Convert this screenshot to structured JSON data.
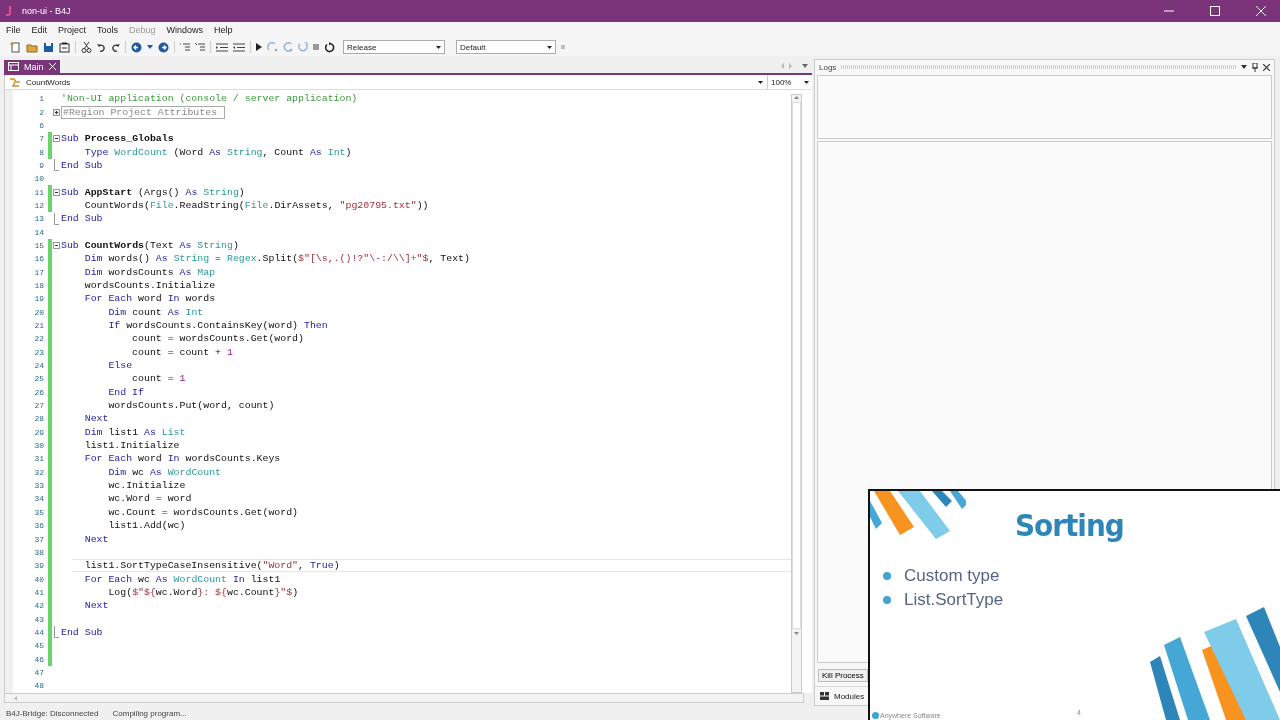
{
  "window": {
    "title": "non-ui - B4J"
  },
  "menu": [
    {
      "label": "File",
      "disabled": false
    },
    {
      "label": "Edit",
      "disabled": false
    },
    {
      "label": "Project",
      "disabled": false
    },
    {
      "label": "Tools",
      "disabled": false
    },
    {
      "label": "Debug",
      "disabled": true
    },
    {
      "label": "Windows",
      "disabled": false
    },
    {
      "label": "Help",
      "disabled": false
    }
  ],
  "toolbar": {
    "build_config": "Release",
    "build_target": "Default"
  },
  "tabs": [
    {
      "label": "Main",
      "selected": true
    }
  ],
  "editor": {
    "module": "CountWords",
    "zoom": "100%",
    "lines": [
      {
        "number": "1",
        "kind": "code",
        "changed": false,
        "current": false,
        "segments": [
          {
            "kind": "comment",
            "text": "'Non-UI application (console / server application)"
          }
        ]
      },
      {
        "number": "2",
        "kind": "fold_start",
        "expanded": false,
        "changed": false,
        "current": false,
        "segments": [
          {
            "kind": "region",
            "text": "#Region Project Attributes "
          }
        ]
      },
      {
        "number": "6",
        "kind": "code",
        "changed": false,
        "current": false
      },
      {
        "number": "7",
        "kind": "fold_start",
        "expanded": true,
        "changed": true,
        "current": false,
        "segments": [
          {
            "kind": "kw",
            "text": "Sub "
          },
          {
            "kind": "name",
            "text": "Process_Globals"
          }
        ]
      },
      {
        "number": "8",
        "kind": "code",
        "changed": true,
        "current": false,
        "segments": [
          {
            "kind": "kw",
            "text": "    Type "
          },
          {
            "kind": "type",
            "text": "WordCount"
          },
          {
            "kind": "plain",
            "text": " (Word "
          },
          {
            "kind": "kw",
            "text": "As "
          },
          {
            "kind": "type",
            "text": "String"
          },
          {
            "kind": "plain",
            "text": ", Count "
          },
          {
            "kind": "kw",
            "text": "As "
          },
          {
            "kind": "type",
            "text": "Int"
          },
          {
            "kind": "plain",
            "text": ")"
          }
        ]
      },
      {
        "number": "9",
        "kind": "fold_end",
        "changed": false,
        "current": false,
        "segments": [
          {
            "kind": "kw",
            "text": "End Sub"
          }
        ]
      },
      {
        "number": "10",
        "kind": "code",
        "changed": false,
        "current": false
      },
      {
        "number": "11",
        "kind": "fold_start",
        "expanded": true,
        "changed": true,
        "current": false,
        "segments": [
          {
            "kind": "kw",
            "text": "Sub "
          },
          {
            "kind": "name",
            "text": "AppStart"
          },
          {
            "kind": "plain",
            "text": " (Args() "
          },
          {
            "kind": "kw",
            "text": "As "
          },
          {
            "kind": "type",
            "text": "String"
          },
          {
            "kind": "plain",
            "text": ")"
          }
        ]
      },
      {
        "number": "12",
        "kind": "code",
        "changed": true,
        "current": false,
        "segments": [
          {
            "kind": "plain",
            "text": "    CountWords("
          },
          {
            "kind": "type",
            "text": "File"
          },
          {
            "kind": "plain",
            "text": ".ReadString("
          },
          {
            "kind": "type",
            "text": "File"
          },
          {
            "kind": "plain",
            "text": ".DirAssets, "
          },
          {
            "kind": "str",
            "text": "\"pg20795.txt\""
          },
          {
            "kind": "plain",
            "text": "))"
          }
        ]
      },
      {
        "number": "13",
        "kind": "fold_end",
        "changed": false,
        "current": false,
        "segments": [
          {
            "kind": "kw",
            "text": "End Sub"
          }
        ]
      },
      {
        "number": "14",
        "kind": "code",
        "changed": false,
        "current": false
      },
      {
        "number": "15",
        "kind": "fold_start",
        "expanded": true,
        "changed": true,
        "current": false,
        "segments": [
          {
            "kind": "kw",
            "text": "Sub "
          },
          {
            "kind": "name",
            "text": "CountWords"
          },
          {
            "kind": "plain",
            "text": "(Text "
          },
          {
            "kind": "kw",
            "text": "As "
          },
          {
            "kind": "type",
            "text": "String"
          },
          {
            "kind": "plain",
            "text": ")"
          }
        ]
      },
      {
        "number": "16",
        "kind": "code",
        "changed": true,
        "current": false,
        "segments": [
          {
            "kind": "kw",
            "text": "    Dim "
          },
          {
            "kind": "plain",
            "text": "words() "
          },
          {
            "kind": "kw",
            "text": "As "
          },
          {
            "kind": "type",
            "text": "String"
          },
          {
            "kind": "plain",
            "text": " = "
          },
          {
            "kind": "type",
            "text": "Regex"
          },
          {
            "kind": "plain",
            "text": ".Split("
          },
          {
            "kind": "str",
            "text": "$\"[\\s,.()!?\"\\-:/\\\\]+\"$"
          },
          {
            "kind": "plain",
            "text": ", Text)"
          }
        ]
      },
      {
        "number": "17",
        "kind": "code",
        "changed": true,
        "current": false,
        "segments": [
          {
            "kind": "kw",
            "text": "    Dim "
          },
          {
            "kind": "plain",
            "text": "wordsCounts "
          },
          {
            "kind": "kw",
            "text": "As "
          },
          {
            "kind": "type",
            "text": "Map"
          }
        ]
      },
      {
        "number": "18",
        "kind": "code",
        "changed": true,
        "current": false,
        "segments": [
          {
            "kind": "plain",
            "text": "    wordsCounts.Initialize"
          }
        ]
      },
      {
        "number": "19",
        "kind": "code",
        "changed": true,
        "current": false,
        "segments": [
          {
            "kind": "kw",
            "text": "    For Each "
          },
          {
            "kind": "plain",
            "text": "word "
          },
          {
            "kind": "kw",
            "text": "In "
          },
          {
            "kind": "plain",
            "text": "words"
          }
        ]
      },
      {
        "number": "20",
        "kind": "code",
        "changed": true,
        "current": false,
        "segments": [
          {
            "kind": "kw",
            "text": "        Dim "
          },
          {
            "kind": "plain",
            "text": "count "
          },
          {
            "kind": "kw",
            "text": "As "
          },
          {
            "kind": "type",
            "text": "Int"
          }
        ]
      },
      {
        "number": "21",
        "kind": "code",
        "changed": true,
        "current": false,
        "segments": [
          {
            "kind": "kw",
            "text": "        If "
          },
          {
            "kind": "plain",
            "text": "wordsCounts.ContainsKey(word) "
          },
          {
            "kind": "kw",
            "text": "Then"
          }
        ]
      },
      {
        "number": "22",
        "kind": "code",
        "changed": true,
        "current": false,
        "segments": [
          {
            "kind": "plain",
            "text": "            count = wordsCounts.Get(word)"
          }
        ]
      },
      {
        "number": "23",
        "kind": "code",
        "changed": true,
        "current": false,
        "segments": [
          {
            "kind": "plain",
            "text": "            count = count + "
          },
          {
            "kind": "num",
            "text": "1"
          }
        ]
      },
      {
        "number": "24",
        "kind": "code",
        "changed": true,
        "current": false,
        "segments": [
          {
            "kind": "kw",
            "text": "        Else"
          }
        ]
      },
      {
        "number": "25",
        "kind": "code",
        "changed": true,
        "current": false,
        "segments": [
          {
            "kind": "plain",
            "text": "            count = "
          },
          {
            "kind": "num",
            "text": "1"
          }
        ]
      },
      {
        "number": "26",
        "kind": "code",
        "changed": true,
        "current": false,
        "segments": [
          {
            "kind": "kw",
            "text": "        End If"
          }
        ]
      },
      {
        "number": "27",
        "kind": "code",
        "changed": true,
        "current": false,
        "segments": [
          {
            "kind": "plain",
            "text": "        wordsCounts.Put(word, count)"
          }
        ]
      },
      {
        "number": "28",
        "kind": "code",
        "changed": true,
        "current": false,
        "segments": [
          {
            "kind": "kw",
            "text": "    Next"
          }
        ]
      },
      {
        "number": "29",
        "kind": "code",
        "changed": true,
        "current": false,
        "segments": [
          {
            "kind": "kw",
            "text": "    Dim "
          },
          {
            "kind": "plain",
            "text": "list1 "
          },
          {
            "kind": "kw",
            "text": "As "
          },
          {
            "kind": "type",
            "text": "List"
          }
        ]
      },
      {
        "number": "30",
        "kind": "code",
        "changed": true,
        "current": false,
        "segments": [
          {
            "kind": "plain",
            "text": "    list1.Initialize"
          }
        ]
      },
      {
        "number": "31",
        "kind": "code",
        "changed": true,
        "current": false,
        "segments": [
          {
            "kind": "kw",
            "text": "    For Each "
          },
          {
            "kind": "plain",
            "text": "word "
          },
          {
            "kind": "kw",
            "text": "In "
          },
          {
            "kind": "plain",
            "text": "wordsCounts.Keys"
          }
        ]
      },
      {
        "number": "32",
        "kind": "code",
        "changed": true,
        "current": false,
        "segments": [
          {
            "kind": "kw",
            "text": "        Dim "
          },
          {
            "kind": "plain",
            "text": "wc "
          },
          {
            "kind": "kw",
            "text": "As "
          },
          {
            "kind": "type",
            "text": "WordCount"
          }
        ]
      },
      {
        "number": "33",
        "kind": "code",
        "changed": true,
        "current": false,
        "segments": [
          {
            "kind": "plain",
            "text": "        wc.Initialize"
          }
        ]
      },
      {
        "number": "34",
        "kind": "code",
        "changed": true,
        "current": false,
        "segments": [
          {
            "kind": "plain",
            "text": "        wc.Word = word"
          }
        ]
      },
      {
        "number": "35",
        "kind": "code",
        "changed": true,
        "current": false,
        "segments": [
          {
            "kind": "plain",
            "text": "        wc.Count = wordsCounts.Get(word)"
          }
        ]
      },
      {
        "number": "36",
        "kind": "code",
        "changed": true,
        "current": false,
        "segments": [
          {
            "kind": "plain",
            "text": "        list1.Add(wc)"
          }
        ]
      },
      {
        "number": "37",
        "kind": "code",
        "changed": true,
        "current": false,
        "segments": [
          {
            "kind": "kw",
            "text": "    Next"
          }
        ]
      },
      {
        "number": "38",
        "kind": "code",
        "changed": true,
        "current": false
      },
      {
        "number": "39",
        "kind": "code",
        "changed": true,
        "current": true,
        "segments": [
          {
            "kind": "plain",
            "text": "    list1.SortTypeCaseInsensitive("
          },
          {
            "kind": "str",
            "text": "\"Word\""
          },
          {
            "kind": "plain",
            "text": ", "
          },
          {
            "kind": "kw",
            "text": "True"
          },
          {
            "kind": "plain",
            "text": ")"
          }
        ]
      },
      {
        "number": "40",
        "kind": "code",
        "changed": true,
        "current": false,
        "segments": [
          {
            "kind": "kw",
            "text": "    For Each "
          },
          {
            "kind": "plain",
            "text": "wc "
          },
          {
            "kind": "kw",
            "text": "As "
          },
          {
            "kind": "type",
            "text": "WordCount"
          },
          {
            "kind": "kw",
            "text": " In "
          },
          {
            "kind": "plain",
            "text": "list1"
          }
        ]
      },
      {
        "number": "41",
        "kind": "code",
        "changed": true,
        "current": false,
        "segments": [
          {
            "kind": "plain",
            "text": "        Log("
          },
          {
            "kind": "str",
            "text": "$\"${"
          },
          {
            "kind": "plain",
            "text": "wc.Word"
          },
          {
            "kind": "str",
            "text": "}: ${"
          },
          {
            "kind": "plain",
            "text": "wc.Count"
          },
          {
            "kind": "str",
            "text": "}\"$"
          },
          {
            "kind": "plain",
            "text": ")"
          }
        ]
      },
      {
        "number": "42",
        "kind": "code",
        "changed": true,
        "current": false,
        "segments": [
          {
            "kind": "kw",
            "text": "    Next"
          }
        ]
      },
      {
        "number": "43",
        "kind": "code",
        "changed": true,
        "current": false
      },
      {
        "number": "44",
        "kind": "fold_end",
        "changed": true,
        "current": false,
        "segments": [
          {
            "kind": "kw",
            "text": "End Sub"
          }
        ]
      },
      {
        "number": "45",
        "kind": "code",
        "changed": true,
        "current": false
      },
      {
        "number": "46",
        "kind": "code",
        "changed": true,
        "current": false
      },
      {
        "number": "47",
        "kind": "code",
        "changed": false,
        "current": false
      },
      {
        "number": "48",
        "kind": "code",
        "changed": false,
        "current": false
      }
    ]
  },
  "logs_panel": {
    "title": "Logs",
    "kill_button": "Kill Process",
    "bottom_tab": "Modules"
  },
  "status_bar": [
    "B4J-Bridge: Disconnected",
    "Compiling program..."
  ],
  "slide": {
    "title": "Sorting",
    "bullets": [
      "Custom type",
      "List.SortType"
    ],
    "footer": "Anywhere Software",
    "page": "4"
  }
}
